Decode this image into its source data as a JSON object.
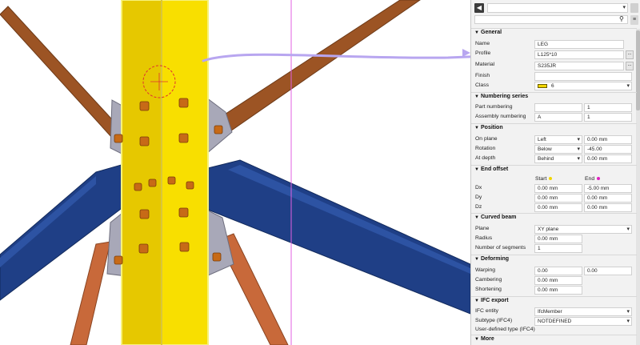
{
  "toolbar": {
    "back_label": "◀",
    "object_type_value": "",
    "search_value": "",
    "search_icon": "search-icon",
    "menu_icon": "hamburger-menu-icon"
  },
  "colors": {
    "section_bar": "#f2d600",
    "start_dot": "#f2d600",
    "end_dot": "#e020c0",
    "class_swatch": "#f2d600",
    "annotation_arrow": "#b8a6f0"
  },
  "sections": {
    "general": "General",
    "numbering": "Numbering series",
    "position": "Position",
    "end_offset": "End offset",
    "curved_beam": "Curved beam",
    "deforming": "Deforming",
    "ifc_export": "IFC export",
    "more": "More"
  },
  "general": {
    "name_label": "Name",
    "name_value": "LEG",
    "profile_label": "Profile",
    "profile_value": "L125*10",
    "material_label": "Material",
    "material_value": "S235JR",
    "finish_label": "Finish",
    "finish_value": "",
    "class_label": "Class",
    "class_value": "6"
  },
  "numbering": {
    "part_label": "Part numbering",
    "part_prefix": "",
    "part_start": "1",
    "assembly_label": "Assembly numbering",
    "assembly_prefix": "A",
    "assembly_start": "1"
  },
  "position": {
    "on_plane_label": "On plane",
    "on_plane_option": "Left",
    "on_plane_value": "0.00 mm",
    "rotation_label": "Rotation",
    "rotation_option": "Below",
    "rotation_value": "-45.00",
    "at_depth_label": "At depth",
    "at_depth_option": "Behind",
    "at_depth_value": "0.00 mm"
  },
  "end_offset": {
    "start_label": "Start",
    "end_label": "End",
    "dx_label": "Dx",
    "dx_start": "0.00 mm",
    "dx_end": "-5.00 mm",
    "dy_label": "Dy",
    "dy_start": "0.00 mm",
    "dy_end": "0.00 mm",
    "dz_label": "Dz",
    "dz_start": "0.00 mm",
    "dz_end": "0.00 mm"
  },
  "curved_beam": {
    "plane_label": "Plane",
    "plane_value": "XY plane",
    "radius_label": "Radius",
    "radius_value": "0.00 mm",
    "segments_label": "Number of segments",
    "segments_value": "1"
  },
  "deforming": {
    "warping_label": "Warping",
    "warping_start": "0.00",
    "warping_end": "0.00",
    "cambering_label": "Cambering",
    "cambering_value": "0.00 mm",
    "shortening_label": "Shortening",
    "shortening_value": "0.00 mm"
  },
  "ifc": {
    "entity_label": "IFC entity",
    "entity_value": "IfcMember",
    "subtype_label": "Subtype (IFC4)",
    "subtype_value": "NOTDEFINED",
    "user_type_label": "User-defined type (IFC4)"
  }
}
